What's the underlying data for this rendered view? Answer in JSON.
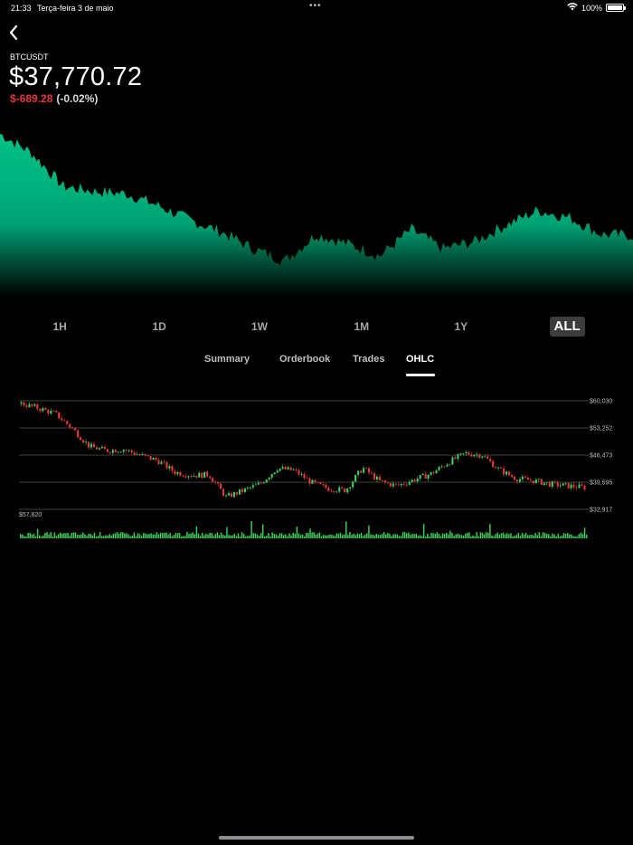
{
  "status_bar": {
    "time": "21:33",
    "date": "Terça-feira 3 de maio",
    "dots": "•••",
    "battery": "100%"
  },
  "header": {
    "symbol": "BTCUSDT",
    "price": "$37,770.72",
    "change_value": "$-689.28",
    "change_percent": "(-0.02%)"
  },
  "colors": {
    "accent_green": "#00b27a",
    "down_red": "#e5383b",
    "candle_up": "#3ecf5e",
    "candle_down": "#e53935",
    "volume": "#3ecf5e",
    "gridline": "#555555"
  },
  "time_ranges": {
    "items": [
      "1H",
      "1D",
      "1W",
      "1M",
      "1Y",
      "ALL"
    ],
    "selected": "ALL"
  },
  "tabs": {
    "items": [
      "Summary",
      "Orderbook",
      "Trades",
      "OHLC"
    ],
    "selected": "OHLC"
  },
  "chart_data": [
    {
      "type": "area",
      "x": [
        0,
        5,
        10,
        15,
        20,
        25,
        30,
        35,
        40,
        45,
        50,
        55,
        60,
        65,
        70,
        75,
        80,
        85,
        90,
        95,
        100
      ],
      "y": [
        59000,
        55000,
        48000,
        47000,
        46500,
        44000,
        41000,
        38500,
        35000,
        32500,
        38000,
        36000,
        33500,
        39000,
        35000,
        36500,
        40000,
        43000,
        41500,
        38000,
        37770
      ],
      "xlabel": "",
      "ylabel": "",
      "ylim": [
        28000,
        62000
      ],
      "grid": false
    },
    {
      "type": "ohlc",
      "price_ticks": [
        "$60,030",
        "$53,252",
        "$46,473",
        "$39,695",
        "$32,917"
      ],
      "price_tick_values": [
        60030,
        53252,
        46473,
        39695,
        32917
      ],
      "ylim": [
        32917,
        60030
      ],
      "close": [
        59300,
        58200,
        56800,
        53100,
        48600,
        47600,
        47900,
        46400,
        45100,
        42200,
        41400,
        41600,
        36000,
        37600,
        39300,
        43200,
        42600,
        39600,
        38100,
        37700,
        43300,
        39900,
        38800,
        40300,
        41800,
        44600,
        46900,
        46500,
        42800,
        40600,
        40100,
        39200,
        38800,
        38400
      ],
      "volume_label": "$57,820",
      "grid": true
    }
  ]
}
